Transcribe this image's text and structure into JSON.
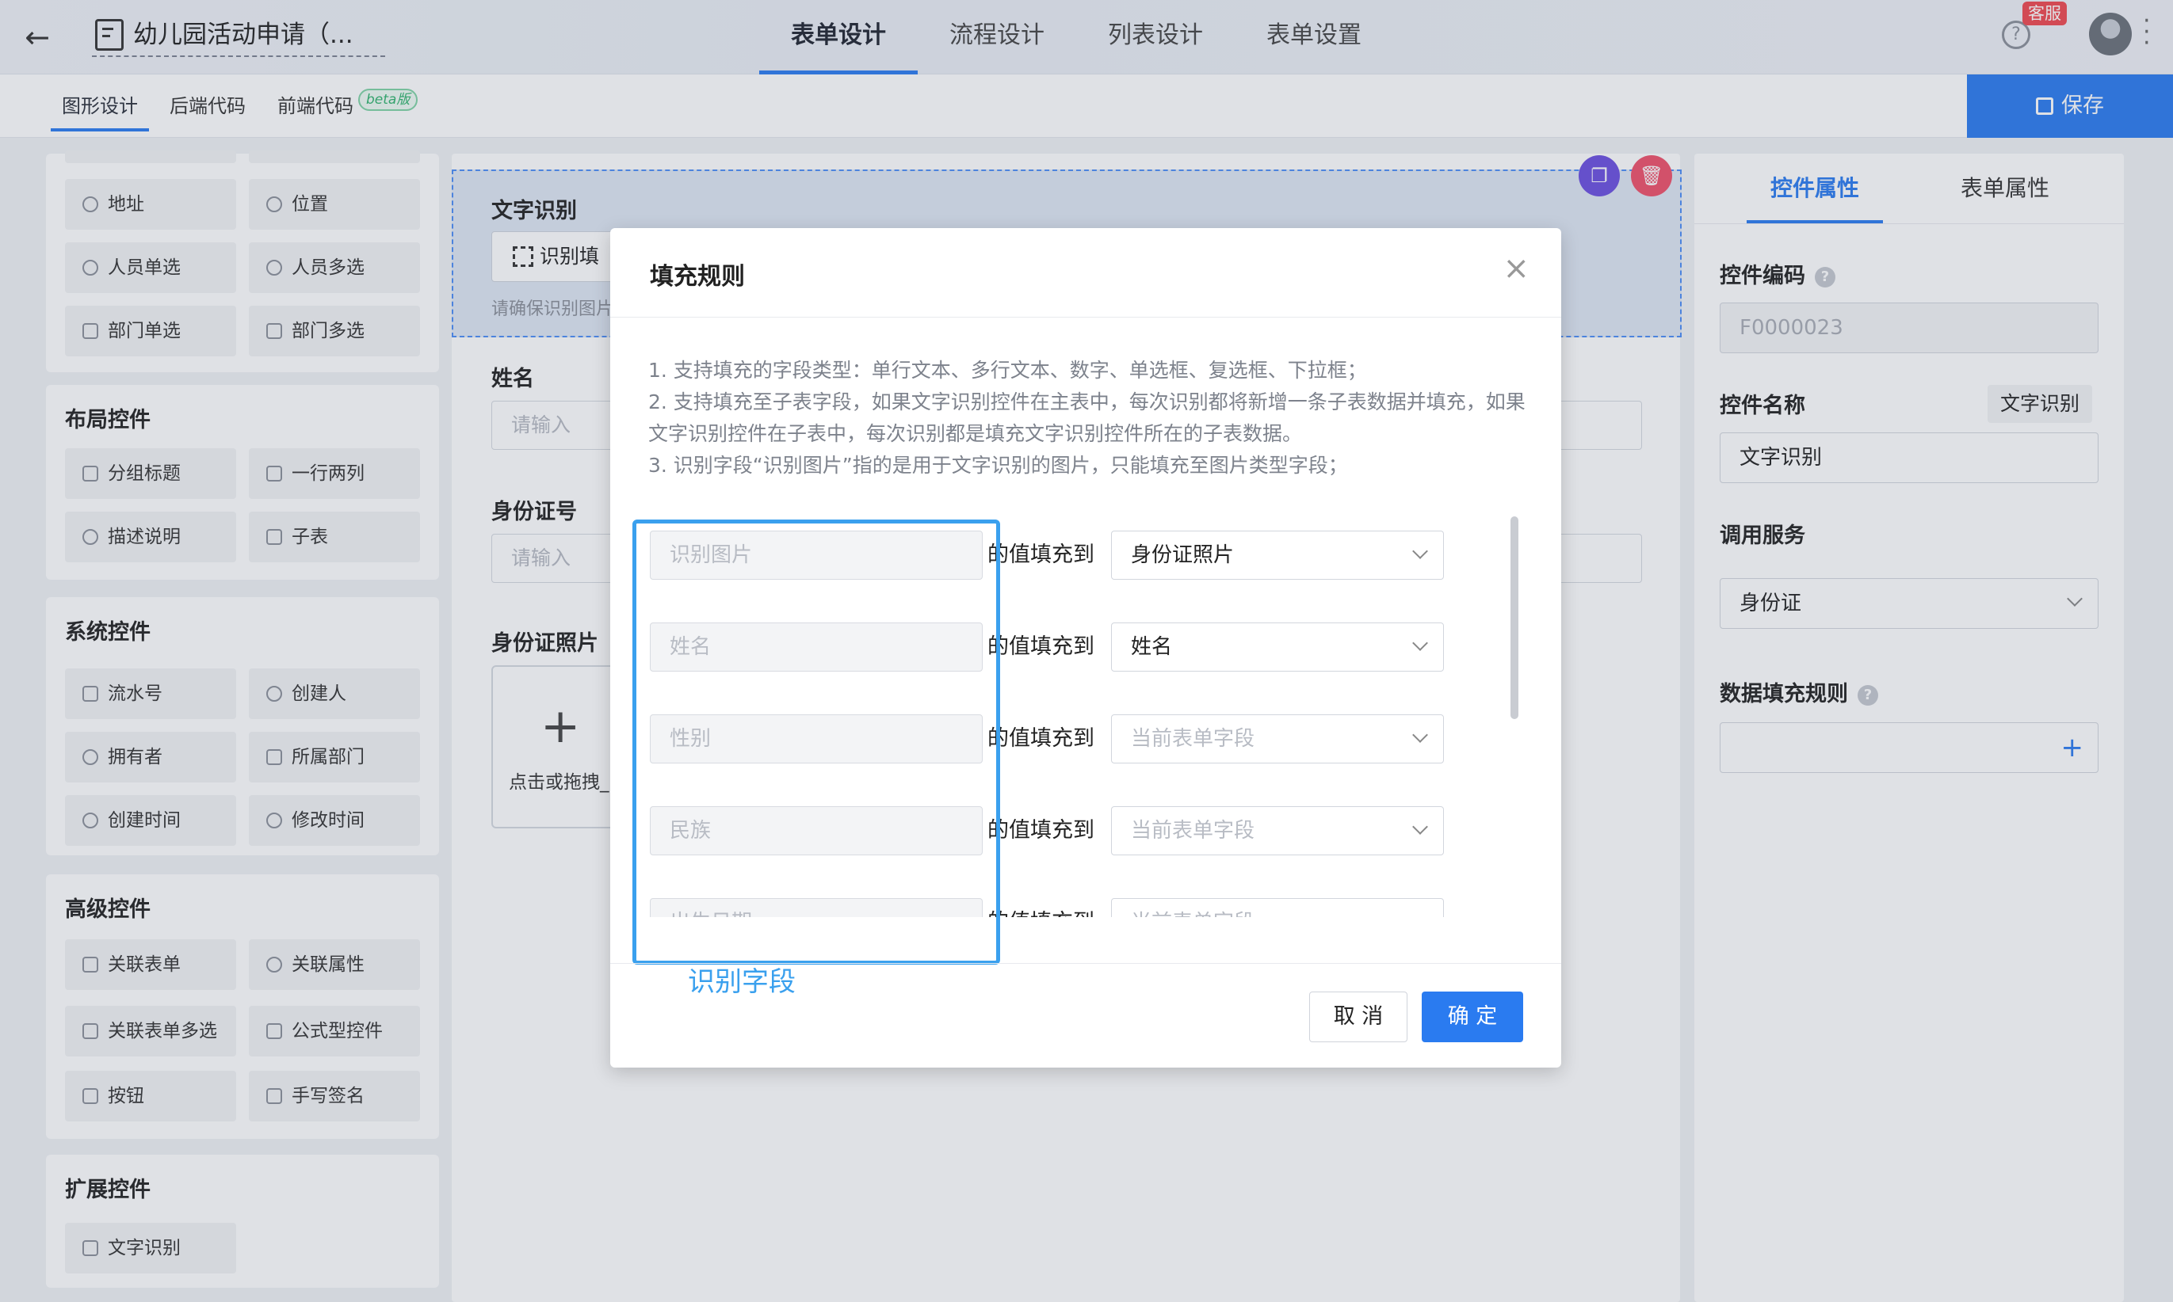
{
  "header": {
    "title": "幼儿园活动申请（...",
    "tabs": [
      "表单设计",
      "流程设计",
      "列表设计",
      "表单设置"
    ],
    "service_badge": "客服"
  },
  "subbar": {
    "tabs": [
      "图形设计",
      "后端代码",
      "前端代码"
    ],
    "beta": "beta版",
    "save": "保存"
  },
  "palette": {
    "top_chips": [
      "地址",
      "位置",
      "人员单选",
      "人员多选",
      "部门单选",
      "部门多选"
    ],
    "layout": {
      "title": "布局控件",
      "chips": [
        "分组标题",
        "一行两列",
        "描述说明",
        "子表"
      ]
    },
    "system": {
      "title": "系统控件",
      "chips": [
        "流水号",
        "创建人",
        "拥有者",
        "所属部门",
        "创建时间",
        "修改时间"
      ]
    },
    "advanced": {
      "title": "高级控件",
      "chips": [
        "关联表单",
        "关联属性",
        "关联表单多选",
        "公式型控件",
        "按钮",
        "手写签名"
      ]
    },
    "extension": {
      "title": "扩展控件",
      "chips": [
        "文字识别"
      ]
    }
  },
  "canvas": {
    "ocr_label": "文字识别",
    "ocr_button": "识别填",
    "ocr_hint": "请确保识别图片",
    "name_label": "姓名",
    "name_placeholder": "请输入",
    "id_label": "身份证号",
    "id_placeholder": "请输入",
    "photo_label": "身份证照片",
    "upload_text": "点击或拖拽_"
  },
  "right_panel": {
    "tabs": [
      "控件属性",
      "表单属性"
    ],
    "code_label": "控件编码",
    "code_value": "F0000023",
    "name_label": "控件名称",
    "name_tag": "文字识别",
    "name_value": "文字识别",
    "service_label": "调用服务",
    "service_value": "身份证",
    "rule_label": "数据填充规则"
  },
  "dialog": {
    "title": "填充规则",
    "notes": [
      "1. 支持填充的字段类型：单行文本、多行文本、数字、单选框、复选框、下拉框；",
      "2. 支持填充至子表字段，如果文字识别控件在主表中，每次识别都将新增一条子表数据并填充，如果文字识别控件在子表中，每次识别都是填充文字识别控件所在的子表数据。",
      "3. 识别字段“识别图片”指的是用于文字识别的图片，只能填充至图片类型字段；"
    ],
    "fill_to": "的值填充到",
    "rows": [
      {
        "field": "识别图片",
        "target": "身份证照片",
        "placeholder": false
      },
      {
        "field": "姓名",
        "target": "姓名",
        "placeholder": false
      },
      {
        "field": "性别",
        "target": "当前表单字段",
        "placeholder": true
      },
      {
        "field": "民族",
        "target": "当前表单字段",
        "placeholder": true
      },
      {
        "field": "出生日期",
        "target": "当前表单字段",
        "placeholder": true
      }
    ],
    "highlight_label": "识别字段",
    "cancel": "取 消",
    "ok": "确 定"
  }
}
